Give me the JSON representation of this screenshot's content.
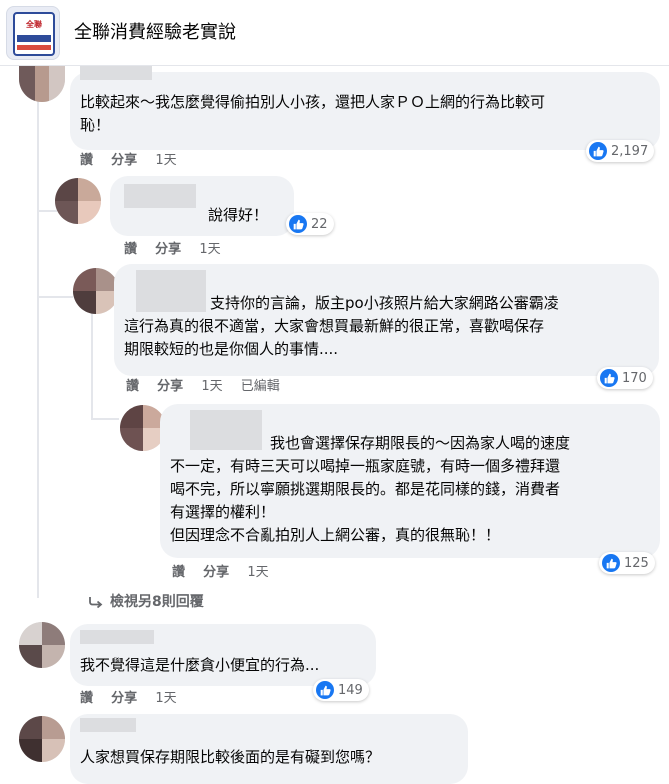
{
  "group": {
    "name": "全聯消費經驗老實說",
    "logo_text": "全聯"
  },
  "colors": {
    "accent": "#1877f2",
    "bubble": "#f0f2f5",
    "meta_text": "#65676b"
  },
  "comments": [
    {
      "text": "比較起來～我怎麼覺得偷拍別人小孩，還把人家ＰＯ上網的行為比較可\n恥！",
      "actions": [
        "讚",
        "分享",
        "1天"
      ],
      "reactions": "2,197",
      "reaction_icon": "like-icon"
    },
    {
      "text": "說得好！",
      "actions": [
        "讚",
        "分享",
        "1天"
      ],
      "reactions": "22",
      "reaction_icon": "like-icon"
    },
    {
      "text": "支持你的言論，版主po小孩照片給大家網路公審霸凌\n這行為真的很不適當，大家會想買最新鮮的很正常，喜歡喝保存\n期限較短的也是你個人的事情....",
      "actions": [
        "讚",
        "分享",
        "1天",
        "已編輯"
      ],
      "reactions": "170",
      "reaction_icon": "like-icon"
    },
    {
      "text": "我也會選擇保存期限長的～因為家人喝的速度\n不一定，有時三天可以喝掉一瓶家庭號，有時一個多禮拜還\n喝不完，所以寧願挑選期限長的。都是花同樣的錢，消費者\n有選擇的權利！\n但因理念不合亂拍別人上網公審，真的很無恥！！",
      "actions": [
        "讚",
        "分享",
        "1天"
      ],
      "reactions": "125",
      "reaction_icon": "like-icon"
    },
    {
      "text": "我不覺得這是什麼貪小便宜的行為...",
      "actions": [
        "讚",
        "分享",
        "1天"
      ],
      "reactions": "149",
      "reaction_icon": "like-icon"
    },
    {
      "text": "人家想買保存期限比較後面的是有礙到您嗎？",
      "actions": [],
      "reactions": "",
      "reaction_icon": ""
    }
  ],
  "view_more": {
    "label": "檢視另8則回覆",
    "icon": "reply-arrow-icon"
  }
}
